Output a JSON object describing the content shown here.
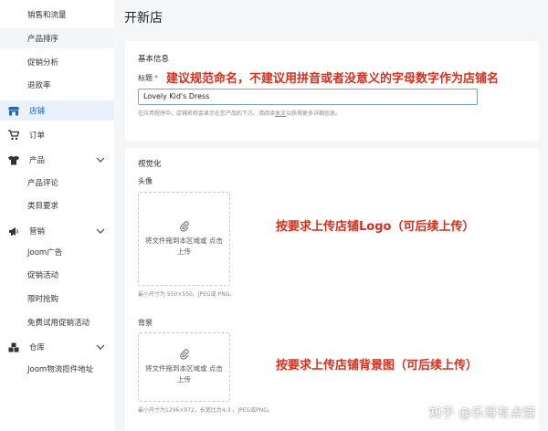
{
  "sidebar": {
    "items": [
      {
        "label": "销售和流量",
        "type": "sub"
      },
      {
        "label": "产品排序",
        "type": "sub"
      },
      {
        "label": "促销分析",
        "type": "sub"
      },
      {
        "label": "退款率",
        "type": "sub"
      },
      {
        "label": "店铺",
        "type": "top",
        "icon": "store-icon"
      },
      {
        "label": "订单",
        "type": "top",
        "icon": "cart-icon"
      },
      {
        "label": "产品",
        "type": "top",
        "icon": "shirt-icon"
      },
      {
        "label": "产品评论",
        "type": "sub"
      },
      {
        "label": "类目要求",
        "type": "sub"
      },
      {
        "label": "营销",
        "type": "top",
        "icon": "megaphone-icon"
      },
      {
        "label": "Joom广告",
        "type": "sub"
      },
      {
        "label": "促销活动",
        "type": "sub"
      },
      {
        "label": "限时抢购",
        "type": "sub"
      },
      {
        "label": "免费试用促销活动",
        "type": "sub"
      },
      {
        "label": "仓库",
        "type": "top",
        "icon": "warehouse-icon"
      },
      {
        "label": "Joom物流揽件地址",
        "type": "sub"
      }
    ],
    "accent_color": "#1a66c9"
  },
  "page": {
    "title": "开新店"
  },
  "basic_info": {
    "section_title": "基本信息",
    "name_label": "标题",
    "required_mark": "*",
    "name_value": "Lovely Kid's Dress",
    "annotation": "建议规范命名，不建议用拼音或者没意义的字母数字作为店铺名",
    "hint_prefix": "在应用程序中，店铺名称会显示在您产品的下方。请阅读",
    "hint_link": "本文",
    "hint_suffix": "以获得更多详细信息。"
  },
  "visual": {
    "section_title": "视觉化",
    "avatar_label": "头像",
    "avatar_drop_text": "将文件拖到本区域或 点击 上传",
    "avatar_hint": "最小尺寸为 550×550。JPEG或 PNG。",
    "avatar_annotation": "按要求上传店铺Logo（可后续上传）",
    "background_label": "背景",
    "background_drop_text": "将文件拖到本区域或 点击 上传",
    "background_hint": "最小尺寸为1296×972，长宽比为4:3 。JPEG或PNG。",
    "background_annotation": "按要求上传店铺背景图（可后续上传）",
    "annotation_color": "#d62f1e"
  },
  "watermark": {
    "text": "知乎 @乐哥有点懂"
  }
}
